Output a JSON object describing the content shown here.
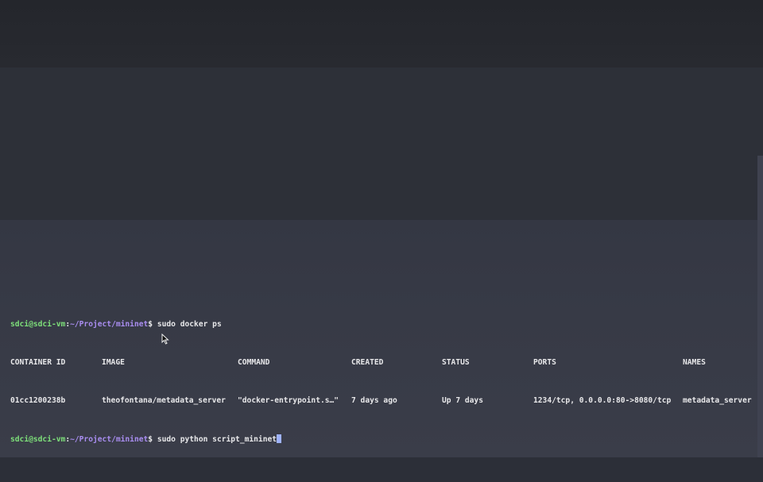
{
  "terminal": {
    "lines": {
      "cmd1": {
        "user_host": "sdci@sdci-vm",
        "sep": ":",
        "path": "~/Project/mininet",
        "dollar": "$",
        "command": " sudo docker ps"
      },
      "cmd2": {
        "user_host": "sdci@sdci-vm",
        "sep": ":",
        "path": "~/Project/mininet",
        "dollar": "$",
        "command": " sudo python script_mininet"
      }
    },
    "table": {
      "headers": [
        "CONTAINER ID",
        "IMAGE",
        "COMMAND",
        "CREATED",
        "STATUS",
        "PORTS",
        "NAMES"
      ],
      "rows": [
        [
          "01cc1200238b",
          "theofontana/metadata_server",
          "\"docker-entrypoint.s…\"",
          "7 days ago",
          "Up 7 days",
          "1234/tcp, 0.0.0.0:80->8080/tcp",
          "metadata_server"
        ]
      ]
    }
  },
  "colors": {
    "prompt_user": "#7ee07a",
    "prompt_path": "#a98df0",
    "cursor": "#9fb3ff",
    "text": "#e8e8ea"
  },
  "icons": {
    "mouse_pointer": "arrow-pointer-icon"
  }
}
